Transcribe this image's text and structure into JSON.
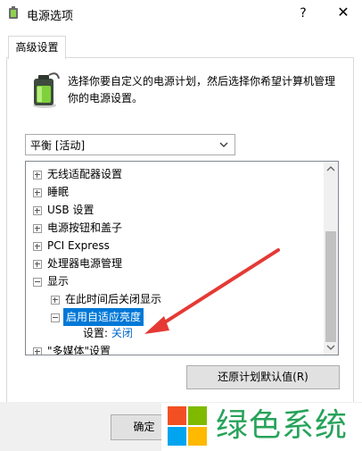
{
  "window": {
    "title": "电源选项",
    "help_label": "?",
    "close_label": "✕"
  },
  "tabs": [
    {
      "label": "高级设置"
    }
  ],
  "description": "选择你要自定义的电源计划，然后选择你希望计算机管理你的电源设置。",
  "plan_select": {
    "value": "平衡 [活动]"
  },
  "tree": {
    "items": [
      {
        "label": "无线适配器设置"
      },
      {
        "label": "睡眠"
      },
      {
        "label": "USB 设置"
      },
      {
        "label": "电源按钮和盖子"
      },
      {
        "label": "PCI Express"
      },
      {
        "label": "处理器电源管理"
      },
      {
        "label": "显示"
      },
      {
        "label": "在此时间后关闭显示"
      },
      {
        "label": "启用自适应亮度"
      },
      {
        "label": "\"多媒体\"设置"
      }
    ],
    "setting_label": "设置:",
    "setting_value": "关闭"
  },
  "buttons": {
    "restore": "还原计划默认值(R)",
    "ok": "确定"
  },
  "watermark": {
    "text": "绿色系统"
  },
  "colors": {
    "selection": "#0078d7",
    "link": "#0066cc",
    "arrow": "#e53935",
    "watermark_green": "#27a35a"
  },
  "icons": [
    "power-options-icon",
    "help-icon",
    "close-icon",
    "battery-icon",
    "dropdown-arrow-icon",
    "expand-icon",
    "collapse-icon"
  ]
}
